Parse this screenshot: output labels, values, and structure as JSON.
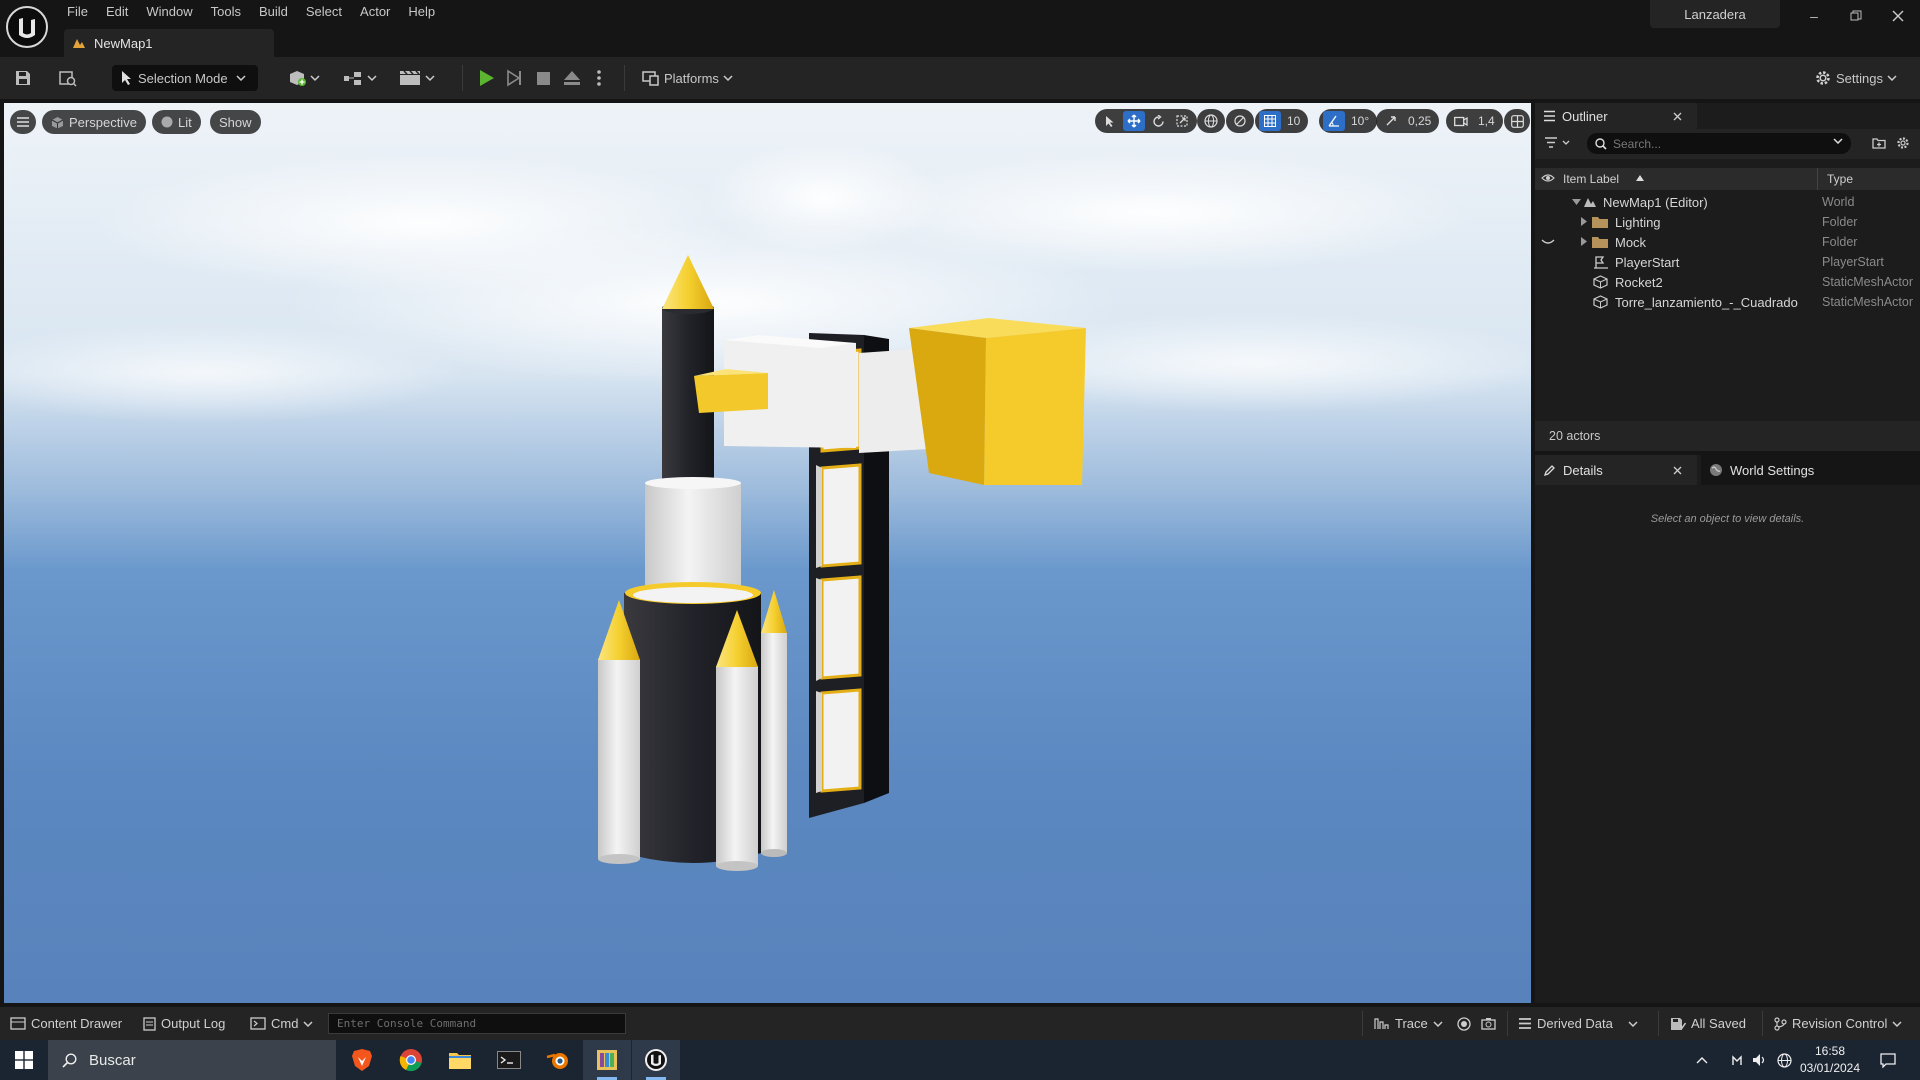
{
  "window": {
    "project_name": "Lanzadera",
    "document_tab": "NewMap1",
    "menu": [
      "File",
      "Edit",
      "Window",
      "Tools",
      "Build",
      "Select",
      "Actor",
      "Help"
    ]
  },
  "toolbar": {
    "selection_mode": "Selection Mode",
    "platforms": "Platforms",
    "settings": "Settings"
  },
  "viewport": {
    "view_mode": "Perspective",
    "lighting": "Lit",
    "show": "Show",
    "grid_snap": "10",
    "rotation_snap": "10°",
    "scale_snap": "0,25",
    "camera_speed": "1,4"
  },
  "outliner": {
    "tab": "Outliner",
    "search_placeholder": "Search...",
    "col_label": "Item Label",
    "col_type": "Type",
    "items": [
      {
        "label": "NewMap1 (Editor)",
        "type": "World"
      },
      {
        "label": "Lighting",
        "type": "Folder"
      },
      {
        "label": "Mock",
        "type": "Folder"
      },
      {
        "label": "PlayerStart",
        "type": "PlayerStart"
      },
      {
        "label": "Rocket2",
        "type": "StaticMeshActor"
      },
      {
        "label": "Torre_lanzamiento_-_Cuadrado",
        "type": "StaticMeshActor"
      }
    ],
    "actor_count": "20 actors"
  },
  "details": {
    "tab": "Details",
    "world_settings_tab": "World Settings",
    "empty_message": "Select an object to view details."
  },
  "statusbar": {
    "content_drawer": "Content Drawer",
    "output_log": "Output Log",
    "cmd": "Cmd",
    "console_placeholder": "Enter Console Command",
    "trace": "Trace",
    "derived_data": "Derived Data",
    "all_saved": "All Saved",
    "revision_control": "Revision Control"
  },
  "taskbar": {
    "search": "Buscar",
    "time": "16:58",
    "date": "03/01/2024"
  },
  "colors": {
    "accent_blue": "#2d6fc7",
    "play_green": "#5cb531",
    "rocket_yellow": "#f5cb2b"
  }
}
